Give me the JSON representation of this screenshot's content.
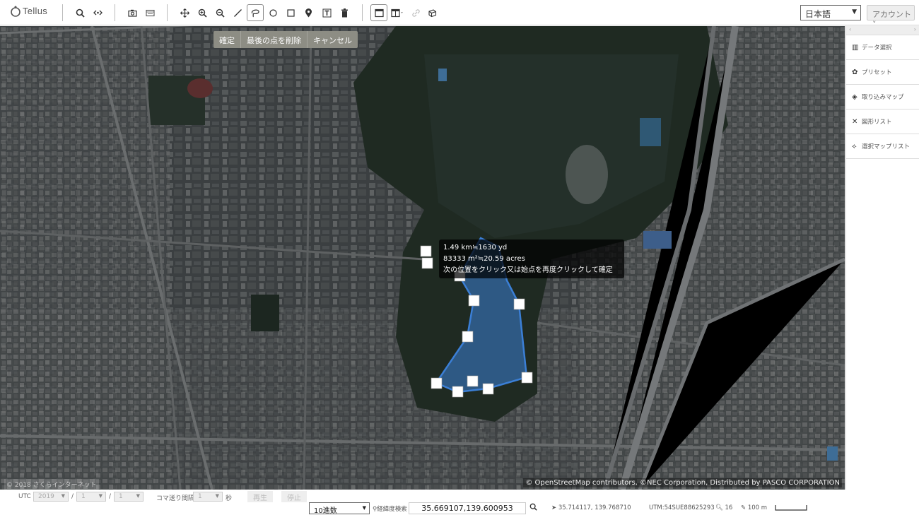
{
  "app": {
    "logo_text": "Tellus"
  },
  "toolbar": {
    "tools": [
      "search-icon",
      "link-icon",
      "camera-icon",
      "film-icon",
      "move-icon",
      "zoom-in-icon",
      "zoom-out-icon",
      "line-icon",
      "lasso-icon",
      "circle-icon",
      "square-icon",
      "marker-icon",
      "text-icon",
      "trash-icon",
      "window-icon",
      "split-window-icon",
      "chain-icon",
      "cube-icon"
    ],
    "active_tool": "lasso-icon",
    "language": "日本語",
    "account": "アカウント"
  },
  "draw_toolbar": {
    "confirm": "確定",
    "remove_last_point": "最後の点を削除",
    "cancel": "キャンセル"
  },
  "tooltip": {
    "distance": "1.49 km≒1630 yd",
    "area": "83333 m²≒20.59 acres",
    "instruction": "次の位置をクリック又は始点を再度クリックして確定"
  },
  "map": {
    "copyright": "© 2018 さくらインターネット",
    "attribution": "© OpenStreetMap contributors, ©NEC Corporation, Distributed by PASCO CORPORATION",
    "polygon_color": "#3b7fd6"
  },
  "sidebar": {
    "items": [
      {
        "icon": "data-icon",
        "label": "データ選択"
      },
      {
        "icon": "palette-icon",
        "label": "プリセット"
      },
      {
        "icon": "layers-icon",
        "label": "取り込みマップ"
      },
      {
        "icon": "shapes-icon",
        "label": "図形リスト"
      },
      {
        "icon": "map-pin-icon",
        "label": "選択マップリスト"
      }
    ]
  },
  "timebar": {
    "utc_label": "UTC",
    "year": "2019",
    "month": "1",
    "day": "1",
    "frame_interval_label": "コマ送り間隔",
    "interval_value": "1",
    "seconds_label": "秒",
    "play_label": "再生",
    "stop_label": "停止"
  },
  "statusbar": {
    "coord_format": "10進数",
    "search_label": "経緯度検索",
    "coord_value": "35.669107,139.600953",
    "cursor_coords": "35.714117, 139.768710",
    "utm": "UTM:54SUE88625293",
    "zoom": "16",
    "scale": "100 m"
  }
}
